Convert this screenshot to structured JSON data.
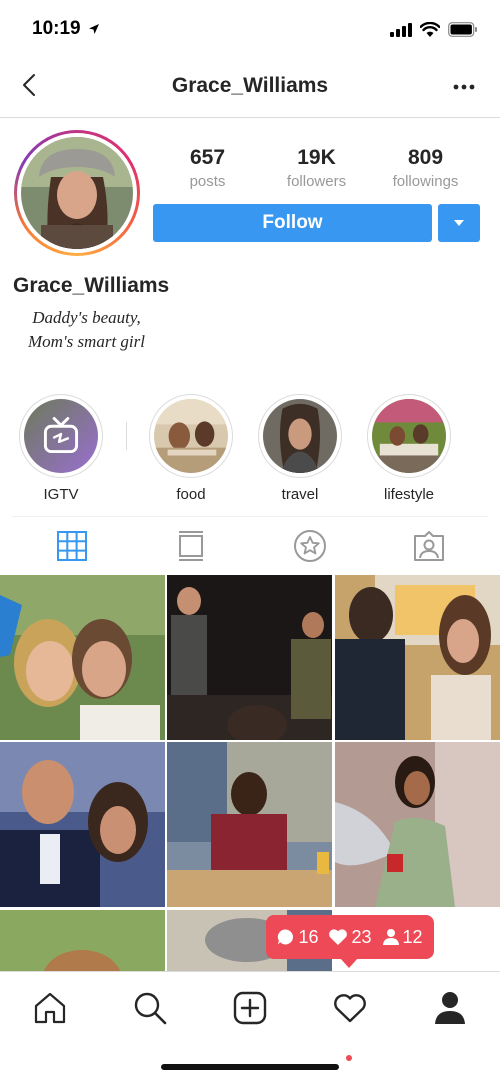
{
  "status": {
    "time": "10:19"
  },
  "nav": {
    "title": "Grace_Williams",
    "back_icon": "chevron-left-icon",
    "more_icon": "more-dots-icon"
  },
  "profile": {
    "stats": [
      {
        "value": "657",
        "label": "posts"
      },
      {
        "value": "19K",
        "label": "followers"
      },
      {
        "value": "809",
        "label": "followings"
      }
    ],
    "follow_label": "Follow",
    "name": "Grace_Williams",
    "bio_line1": "Daddy's beauty,",
    "bio_line2": "Mom's smart girl"
  },
  "highlights": [
    {
      "label": "IGTV"
    },
    {
      "label": "food"
    },
    {
      "label": "travel"
    },
    {
      "label": "lifestyle"
    }
  ],
  "tabs": [
    "grid-icon",
    "feed-icon",
    "star-icon",
    "tagged-icon"
  ],
  "notification": {
    "comments": "16",
    "likes": "23",
    "followers": "12"
  },
  "colors": {
    "accent": "#3897f0",
    "notification": "#ed4956"
  }
}
